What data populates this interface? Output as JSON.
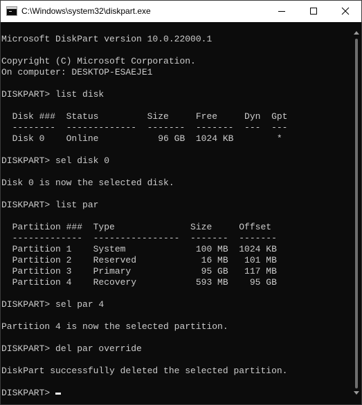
{
  "window": {
    "title": "C:\\Windows\\system32\\diskpart.exe",
    "icon": "console-app-icon",
    "controls": {
      "minimize_icon": "minimize-icon",
      "maximize_icon": "maximize-icon",
      "close_icon": "close-icon"
    }
  },
  "console": {
    "lines": [
      "",
      "Microsoft DiskPart version 10.0.22000.1",
      "",
      "Copyright (C) Microsoft Corporation.",
      "On computer: DESKTOP-ESAEJE1",
      "",
      "DISKPART> list disk",
      "",
      "  Disk ###  Status         Size     Free     Dyn  Gpt",
      "  --------  -------------  -------  -------  ---  ---",
      "  Disk 0    Online           96 GB  1024 KB        *",
      "",
      "DISKPART> sel disk 0",
      "",
      "Disk 0 is now the selected disk.",
      "",
      "DISKPART> list par",
      "",
      "  Partition ###  Type              Size     Offset",
      "  -------------  ----------------  -------  -------",
      "  Partition 1    System             100 MB  1024 KB",
      "  Partition 2    Reserved            16 MB   101 MB",
      "  Partition 3    Primary             95 GB   117 MB",
      "  Partition 4    Recovery           593 MB    95 GB",
      "",
      "DISKPART> sel par 4",
      "",
      "Partition 4 is now the selected partition.",
      "",
      "DISKPART> del par override",
      "",
      "DiskPart successfully deleted the selected partition.",
      ""
    ],
    "prompt": "DISKPART> "
  },
  "colors": {
    "background": "#0c0c0c",
    "foreground": "#cccccc",
    "titlebar": "#ffffff"
  }
}
